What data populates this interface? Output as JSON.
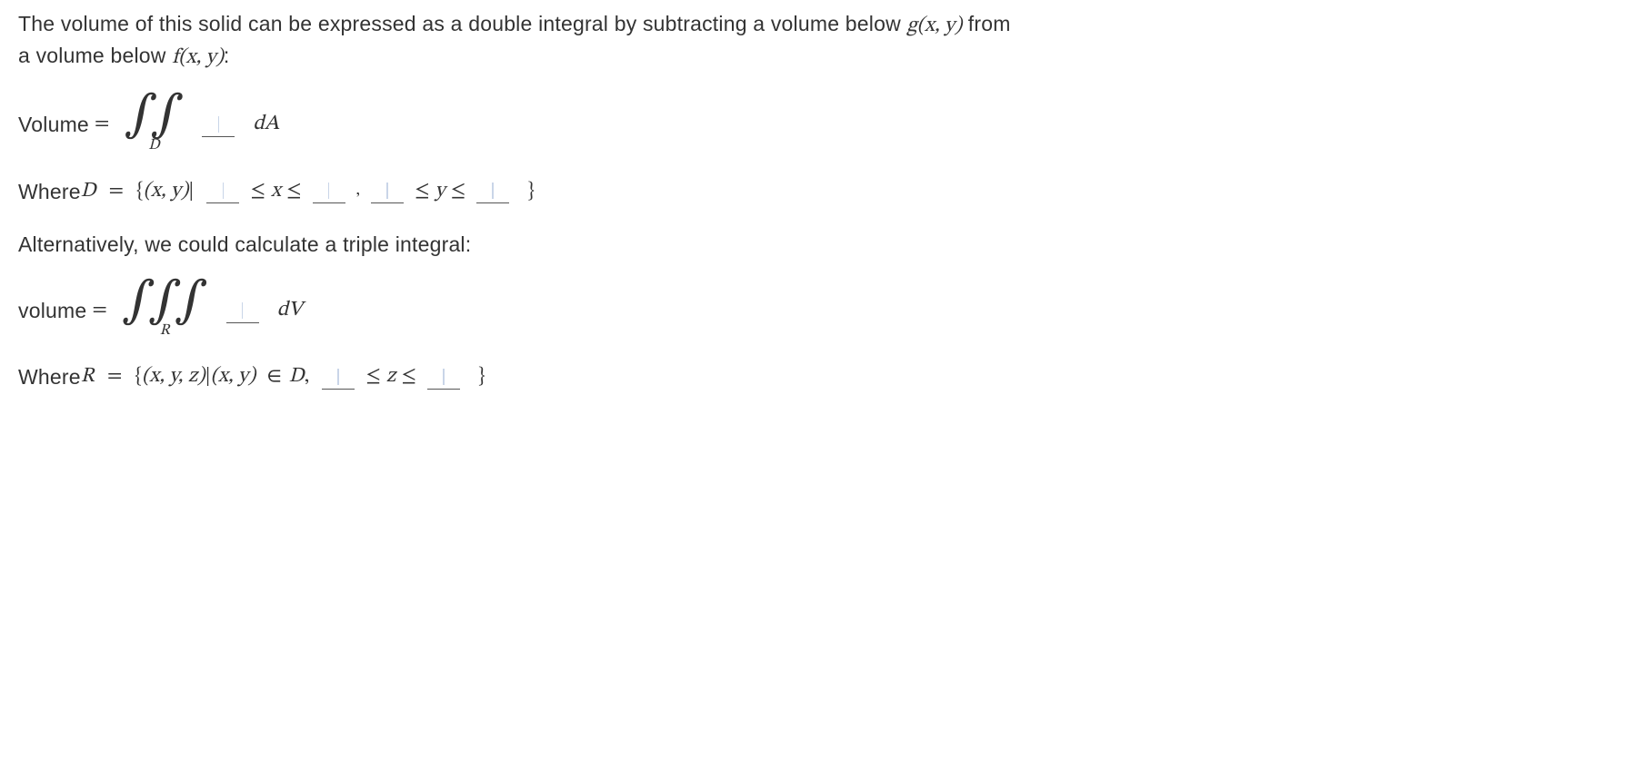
{
  "intro": "The volume of this solid can be expressed as a double integral by subtracting a volume below ",
  "intro_g": "g(x, y)",
  "intro_mid": " from a volume below ",
  "intro_f": "f(x, y)",
  "intro_end": ":",
  "line_vol_label": "Volume ",
  "eq": "=",
  "int2_symbol": "∫∫",
  "int2_sub": "D",
  "dA": "dA",
  "where_label": "Where ",
  "D_eq": "D",
  "set_open": "{",
  "set_pair_xy": "(x, y)",
  "such_that": "|",
  "leq": "≤",
  "x_var": "x",
  "comma": ",",
  "y_var": "y",
  "set_close": "}",
  "alt_text": "Alternatively, we could calculate a triple integral:",
  "line_vol_label2": "volume ",
  "int3_symbol": "∫∫∫",
  "int3_sub": "R",
  "dV": "dV",
  "R_eq": "R",
  "set_triple": "(x, y, z)",
  "in": "∈",
  "D_sym": "D",
  "z_var": "z"
}
